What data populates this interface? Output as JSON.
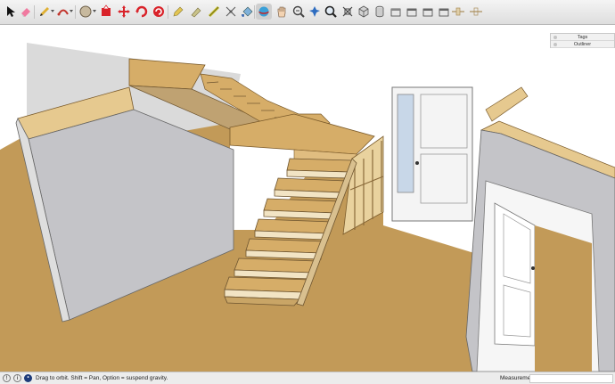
{
  "toolbar": {
    "tools": [
      {
        "name": "select-tool",
        "icon": "arrow-icon"
      },
      {
        "name": "eraser-tool",
        "icon": "eraser-icon"
      },
      {
        "name": "line-tool",
        "icon": "pencil-icon"
      },
      {
        "name": "arc-tool",
        "icon": "arc-icon"
      },
      {
        "name": "circle-tool",
        "icon": "circle-icon"
      },
      {
        "name": "push-pull-tool",
        "icon": "push-pull-icon"
      },
      {
        "name": "move-tool",
        "icon": "move-icon"
      },
      {
        "name": "rotate-tool",
        "icon": "rotate-icon"
      },
      {
        "name": "scale-tool",
        "icon": "scale-icon"
      },
      {
        "name": "offset-tool",
        "icon": "offset-icon"
      },
      {
        "name": "tape-measure-tool",
        "icon": "tape-icon"
      },
      {
        "name": "dimension-tool",
        "icon": "dimension-icon"
      },
      {
        "name": "orbit-tool",
        "icon": "orbit-icon"
      },
      {
        "name": "pan-tool",
        "icon": "hand-icon"
      },
      {
        "name": "zoom-extents-tool",
        "icon": "zoom-extents-icon"
      },
      {
        "name": "zoom-tool",
        "icon": "magnifier-icon"
      },
      {
        "name": "walk-tool",
        "icon": "walk-icon"
      },
      {
        "name": "section-plane-tool",
        "icon": "section-icon"
      }
    ]
  },
  "trays": {
    "tags": "Tags",
    "outliner": "Outliner"
  },
  "status": {
    "message": "Drag to orbit. Shift = Pan, Option = suspend gravity.",
    "measurements_label": "Measurements",
    "measurements_value": ""
  },
  "colors": {
    "floor": "#c29a58",
    "wall_gray": "#c4c4c8",
    "wall_white": "#ffffff",
    "wood": "#d6ad68",
    "wall_top": "#e8cf98"
  }
}
